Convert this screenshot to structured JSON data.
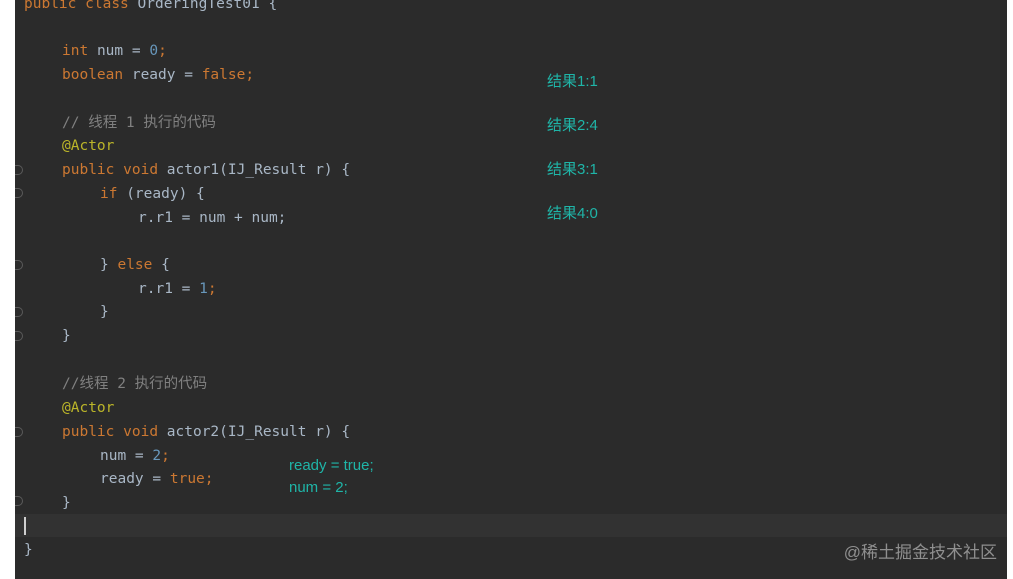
{
  "code": {
    "class_line": {
      "kw1": "public",
      "kw2": "class",
      "name": "OrderingTest01",
      "brace": "{"
    },
    "field_num": {
      "type": "int",
      "name": "num",
      "op": "=",
      "value": "0",
      "end": ";"
    },
    "field_ready": {
      "type": "boolean",
      "name": "ready",
      "op": "=",
      "value": "false",
      "end": ";"
    },
    "comment1": "// 线程 1 执行的代码",
    "annotation1": "@Actor",
    "actor1_sig": {
      "kw1": "public",
      "kw2": "void",
      "name": "actor1",
      "params": "(IJ_Result r) {"
    },
    "if_line": {
      "kw": "if",
      "rest": " (ready) {"
    },
    "r1_sum": {
      "lhs": "r.r1",
      "rhs": " = num + num;"
    },
    "else_line": {
      "close": "} ",
      "kw": "else",
      "open": " {"
    },
    "r1_assign": {
      "lhs": "r.r1",
      "eq": " = ",
      "value": "1",
      "end": ";"
    },
    "close_inner": "}",
    "close_actor1": "}",
    "comment2": "//线程 2 执行的代码",
    "annotation2": "@Actor",
    "actor2_sig": {
      "kw1": "public",
      "kw2": "void",
      "name": "actor2",
      "params": "(IJ_Result r) {"
    },
    "num_assign": {
      "lhs": "num",
      "eq": " = ",
      "value": "2",
      "end": ";"
    },
    "ready_assign": {
      "lhs": "ready",
      "eq": " = ",
      "value": "true",
      "end": ";"
    },
    "close_actor2": "}",
    "close_class": "}"
  },
  "notes": {
    "result1": "结果1:1",
    "result2": "结果2:4",
    "result3": "结果3:1",
    "result4": "结果4:0",
    "reorder_line1": "ready = true;",
    "reorder_line2": "num = 2;"
  },
  "watermark": "@稀土掘金技术社区",
  "colors": {
    "background": "#2b2b2b",
    "keyword": "#cc7832",
    "number": "#6897bb",
    "annotation": "#bbb529",
    "comment": "#808080",
    "note": "#1fb5a8"
  }
}
